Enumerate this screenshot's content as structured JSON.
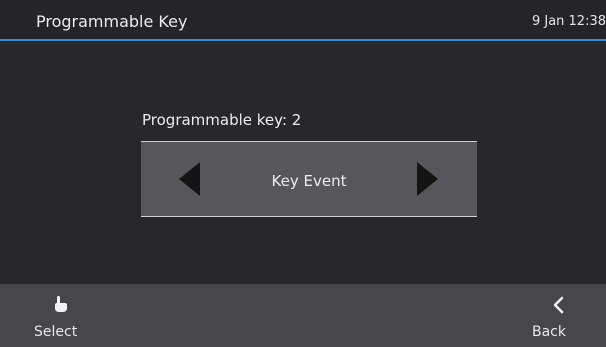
{
  "header": {
    "title": "Programmable Key",
    "datetime": "9 Jan 12:38"
  },
  "main": {
    "field_label": "Programmable key: 2",
    "selector_value": "Key Event",
    "left_arrow_icon": "triangle-left-icon",
    "right_arrow_icon": "triangle-right-icon"
  },
  "softkeys": {
    "left": {
      "label": "Select",
      "icon": "hand-pointer-icon"
    },
    "right": {
      "label": "Back",
      "icon": "chevron-left-icon"
    }
  },
  "colors": {
    "accent": "#2f8fd8",
    "background": "#28282a",
    "selector_bg": "#57575b",
    "softkey_bar": "#47474a"
  }
}
